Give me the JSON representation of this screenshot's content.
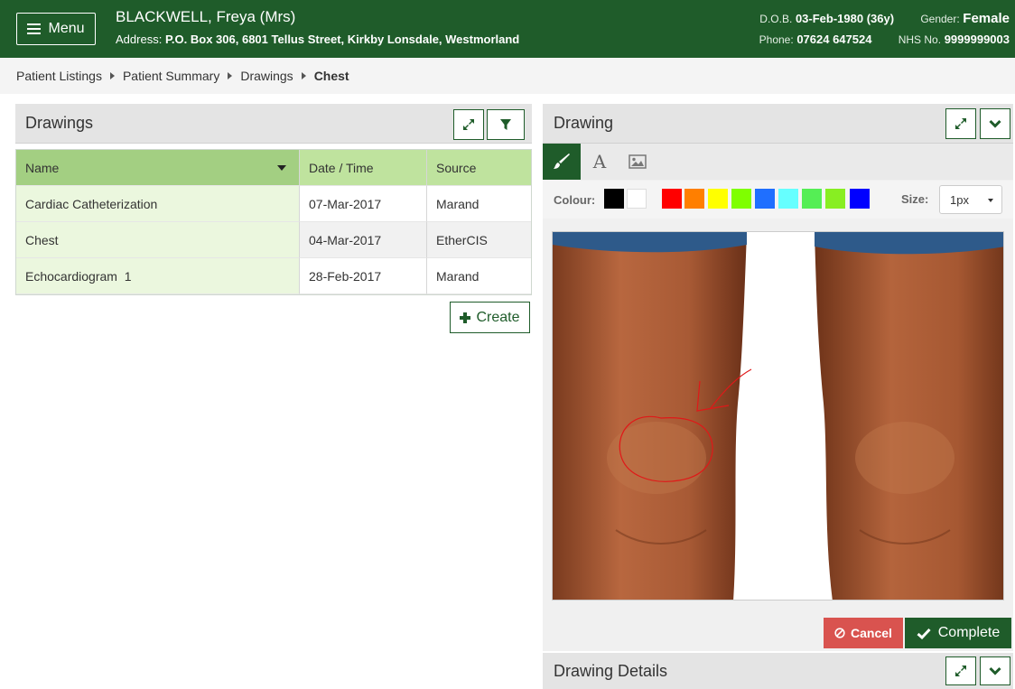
{
  "header": {
    "menu_label": "Menu",
    "patient_name": "BLACKWELL, Freya (Mrs)",
    "address_label": "Address:",
    "address_value": "P.O. Box 306, 6801 Tellus Street, Kirkby Lonsdale, Westmorland",
    "dob_label": "D.O.B.",
    "dob_value": "03-Feb-1980 (36y)",
    "gender_label": "Gender:",
    "gender_value": "Female",
    "phone_label": "Phone:",
    "phone_value": "07624 647524",
    "nhs_label": "NHS No.",
    "nhs_value": "9999999003"
  },
  "breadcrumb": [
    "Patient Listings",
    "Patient Summary",
    "Drawings",
    "Chest"
  ],
  "drawings_panel": {
    "title": "Drawings",
    "columns": [
      "Name",
      "Date / Time",
      "Source"
    ],
    "rows": [
      {
        "name": "Cardiac Catheterization",
        "date": "07-Mar-2017",
        "source": "Marand"
      },
      {
        "name": "Chest",
        "date": "04-Mar-2017",
        "source": "EtherCIS"
      },
      {
        "name": "Echocardiogram  1",
        "date": "28-Feb-2017",
        "source": "Marand"
      }
    ],
    "create_label": "Create"
  },
  "drawing_panel": {
    "title": "Drawing",
    "text_tool_glyph": "A",
    "colour_label": "Colour:",
    "palette": [
      "#000000",
      "#ffffff",
      "#ff0000",
      "#ff7f00",
      "#ffff00",
      "#7fff00",
      "#1f6fff",
      "#66ffff",
      "#55ee55",
      "#88ee22",
      "#0000ff"
    ],
    "size_label": "Size:",
    "size_value": "1px",
    "cancel_label": "Cancel",
    "complete_label": "Complete"
  },
  "details_panel": {
    "title": "Drawing Details"
  },
  "colors": {
    "brand_green": "#1f5c2a",
    "table_header": "#a3cf82",
    "cancel_red": "#d9534f"
  }
}
